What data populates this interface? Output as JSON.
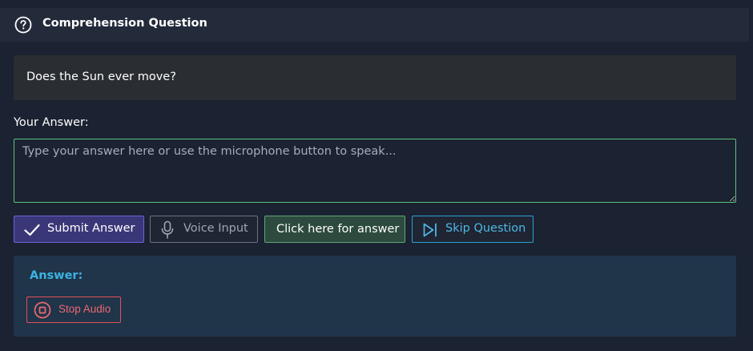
{
  "header": {
    "icon": "help-circle-icon",
    "title": "Comprehension Question"
  },
  "question": {
    "text": "Does the Sun ever move?"
  },
  "answer_field": {
    "label": "Your Answer:",
    "value": "",
    "placeholder": "Type your answer here or use the microphone button to speak...",
    "border_color": "#5fc27c"
  },
  "actions": {
    "submit": {
      "label": "Submit Answer",
      "icon": "checkmark-icon"
    },
    "voice": {
      "label": "Voice Input",
      "icon": "microphone-icon"
    },
    "reveal": {
      "label": "Click here for answer"
    },
    "skip": {
      "label": "Skip Question",
      "icon": "skip-forward-icon"
    }
  },
  "answer_panel": {
    "title": "Answer:",
    "stop_button": {
      "label": "Stop Audio",
      "icon": "stop-circle-icon"
    }
  },
  "colors": {
    "accent_blue": "#3ab4e2",
    "submit_purple": "#6c63d8",
    "reveal_green": "#5fa877",
    "stop_red": "#e0525a"
  }
}
